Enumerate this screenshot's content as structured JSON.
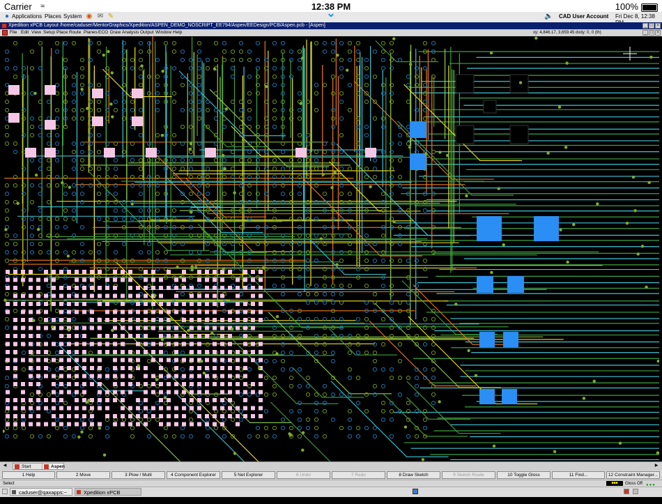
{
  "ios": {
    "carrier": "Carrier",
    "time": "12:38 PM",
    "battery": "100%"
  },
  "gnome": {
    "menus": [
      "Applications",
      "Places",
      "System"
    ],
    "account": "CAD User Account",
    "datetime": "Fri Dec  8, 12:38 PM"
  },
  "window": {
    "title": "Xpedition xPCB Layout  /home/caduser/MentorGraphics/Xpedition/ASPEN_DEMO_NOSCRIPT_EE794/Aspen/EEDesign/PCB/Aspen.pcb - [Aspen]"
  },
  "menubar": {
    "items": [
      "File",
      "Edit",
      "View",
      "Setup",
      "Place",
      "Route",
      "Planes",
      "ECO",
      "Draw",
      "Analysis",
      "Output",
      "Window",
      "Help"
    ],
    "coords": "xy: 4,846.17, 3,659.45  dxdy: 0, 0  (th)"
  },
  "tabs": [
    "Start Page",
    "Aspen"
  ],
  "fkeys": [
    {
      "label": "1 Help",
      "enabled": true
    },
    {
      "label": "2 Move",
      "enabled": true
    },
    {
      "label": "3 Plow / Multi",
      "enabled": true
    },
    {
      "label": "4 Component Explorer",
      "enabled": true
    },
    {
      "label": "5 Net Explorer",
      "enabled": true
    },
    {
      "label": "6 Undo",
      "enabled": false
    },
    {
      "label": "7 Redo",
      "enabled": false
    },
    {
      "label": "8 Draw Sketch",
      "enabled": true
    },
    {
      "label": "9 Sketch Route",
      "enabled": false
    },
    {
      "label": "10 Toggle Gloss",
      "enabled": true
    },
    {
      "label": "11 Find...",
      "enabled": true
    },
    {
      "label": "12 Constraint Manager...",
      "enabled": true
    }
  ],
  "status": {
    "prompt": "Select",
    "gloss": "Gloss Off"
  },
  "taskbar": [
    {
      "label": "caduser@qaxapps:~",
      "active": false
    },
    {
      "label": "Xpedition xPCB Layout...",
      "active": true
    }
  ],
  "colors": {
    "board_bg": "#000000",
    "trace_green": "#3fa33f",
    "trace_yellow": "#f2e21a",
    "trace_cyan": "#3fc6d6",
    "trace_orange": "#ef7a1a",
    "pad_pink": "#f5c6e6",
    "pad_blue": "#2a8ef5"
  }
}
